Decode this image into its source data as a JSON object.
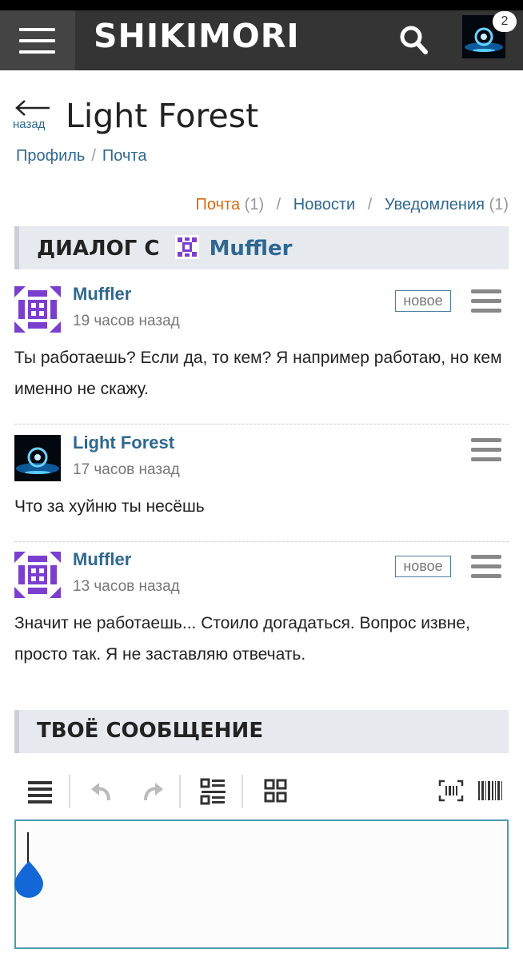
{
  "header": {
    "logo": "SHIKIMORI",
    "notification_count": "2"
  },
  "page": {
    "back_label": "назад",
    "title": "Light Forest",
    "breadcrumb": [
      "Профиль",
      "Почта"
    ]
  },
  "mail_tabs": [
    {
      "label": "Почта",
      "count": "1"
    },
    {
      "label": "Новости",
      "count": ""
    },
    {
      "label": "Уведомления",
      "count": "1"
    }
  ],
  "dialog": {
    "heading_prefix": "ДИАЛОГ С",
    "heading_user": "Muffler"
  },
  "messages": [
    {
      "author": "Muffler",
      "time": "19 часов назад",
      "badge": "новое",
      "text": "Ты работаешь? Если да, то кем? Я например работаю, но кем именно не скажу."
    },
    {
      "author": "Light Forest",
      "time": "17 часов назад",
      "badge": "",
      "text": "Что за хуйню ты несёшь"
    },
    {
      "author": "Muffler",
      "time": "13 часов назад",
      "badge": "новое",
      "text": "Значит не работаешь... Стоило догадаться. Вопрос извне, просто так. Я не заставляю отвечать."
    }
  ],
  "compose": {
    "heading": "ТВОЁ СООБЩЕНИЕ",
    "value": ""
  },
  "colors": {
    "topbar": "#343434",
    "link": "#2f6891",
    "active_tab": "#d86a12",
    "editor_border": "#4a9ab0",
    "muffler_avatar": "#7a3fcf"
  }
}
